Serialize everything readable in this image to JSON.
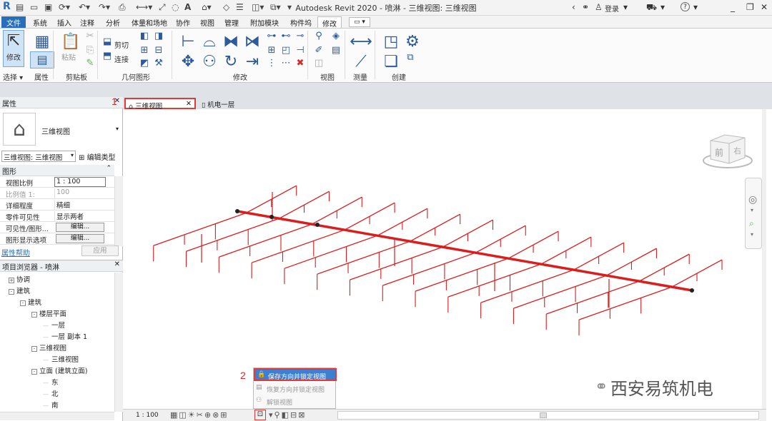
{
  "titlebar": {
    "app_title": "Autodesk Revit 2020 - 喷淋 - 三维视图: 三维视图",
    "login": "登录",
    "help": "?"
  },
  "ribbon_tabs": [
    "文件",
    "系统",
    "插入",
    "注释",
    "分析",
    "体量和场地",
    "协作",
    "视图",
    "管理",
    "附加模块",
    "构件坞",
    "修改"
  ],
  "ribbon": {
    "modify_label": "修改",
    "select_label": "选择 ▾",
    "props_label": "属性",
    "clipboard_label": "剪贴板",
    "paste_label": "粘贴",
    "geometry_label": "几何图形",
    "cut_label": "剪切",
    "join_label": "连接",
    "modify_group_label": "修改",
    "view_label": "视图",
    "measure_label": "测量",
    "create_label": "创建"
  },
  "properties": {
    "title": "属性",
    "type_name": "三维视图",
    "type_selector": "三维视图: 三维视图",
    "edit_type": "编辑类型",
    "section": "图形",
    "rows": [
      {
        "k": "视图比例",
        "v": "1 : 100"
      },
      {
        "k": "比例值 1:",
        "v": "100"
      },
      {
        "k": "详细程度",
        "v": "精细"
      },
      {
        "k": "零件可见性",
        "v": "显示两者"
      },
      {
        "k": "可见性/图形...",
        "v": "编辑..."
      },
      {
        "k": "图形显示选项",
        "v": "编辑..."
      }
    ],
    "help": "属性帮助",
    "apply": "应用"
  },
  "browser": {
    "title": "项目浏览器 - 喷淋",
    "nodes": [
      {
        "label": "协调",
        "exp": "+"
      },
      {
        "label": "建筑",
        "exp": "-"
      },
      {
        "label": "建筑",
        "exp": "-"
      },
      {
        "label": "楼层平面",
        "exp": "-"
      },
      {
        "label": "一层",
        "exp": ""
      },
      {
        "label": "一层 副本 1",
        "exp": ""
      },
      {
        "label": "三维视图",
        "exp": "-"
      },
      {
        "label": "三维视图",
        "exp": ""
      },
      {
        "label": "立面 (建筑立面)",
        "exp": "-"
      },
      {
        "label": "东",
        "exp": ""
      },
      {
        "label": "北",
        "exp": ""
      },
      {
        "label": "南",
        "exp": ""
      }
    ]
  },
  "view_tabs": [
    {
      "label": "三维视图",
      "active": true
    },
    {
      "label": "机电一层",
      "active": false
    }
  ],
  "viewcube": {
    "front": "前",
    "right": "右"
  },
  "popup": {
    "items": [
      "保存方向并锁定视图",
      "恢复方向并锁定视图",
      "解锁视图"
    ]
  },
  "annotations": {
    "step1": "1",
    "step2": "2"
  },
  "status": {
    "scale": "1 : 100"
  },
  "watermark": "西安易筑机电",
  "colors": {
    "pipe": "#d81e1e",
    "highlight": "#e53935",
    "menu_blue": "#3d7fd1"
  }
}
